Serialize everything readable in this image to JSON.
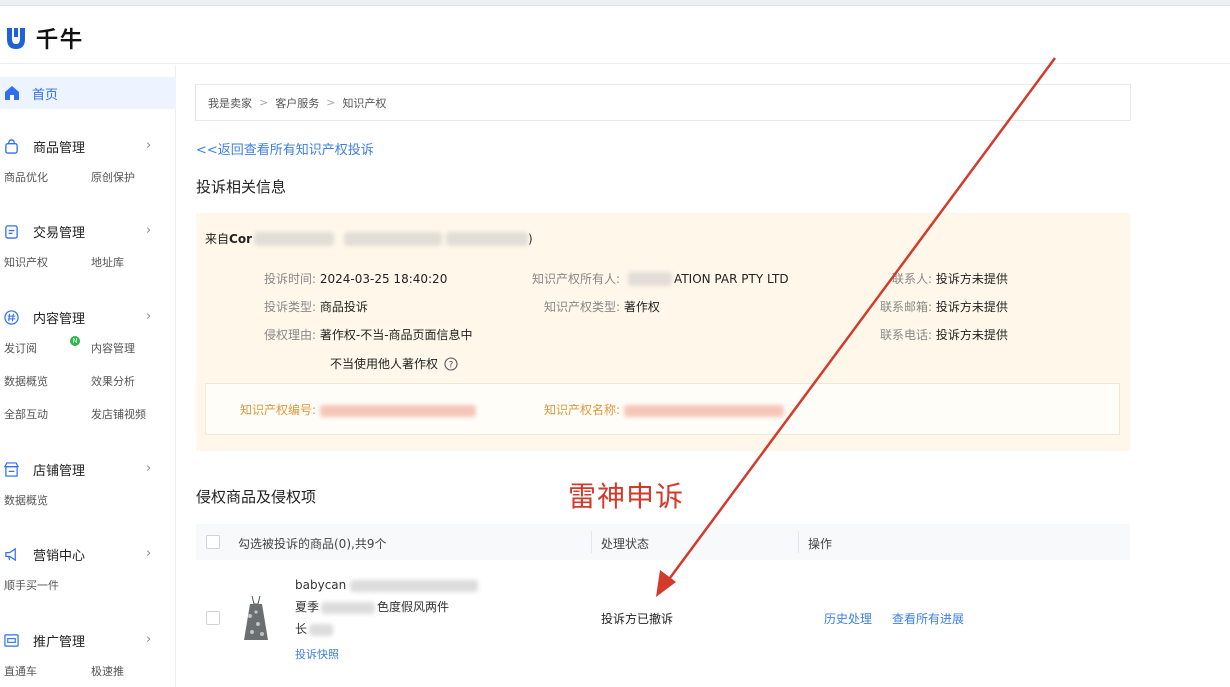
{
  "app": {
    "name": "千牛",
    "logo_icon": "qianniu-logo-icon"
  },
  "sidebar": {
    "home": {
      "label": "首页",
      "icon": "home-icon"
    },
    "groups": [
      {
        "label": "商品管理",
        "icon": "bag-icon",
        "subs": [
          "商品优化",
          "原创保护"
        ]
      },
      {
        "label": "交易管理",
        "icon": "order-icon",
        "subs": [
          "知识产权",
          "地址库"
        ]
      },
      {
        "label": "内容管理",
        "icon": "hash-icon",
        "subs": [
          "发订阅",
          "内容管理",
          "数据概览",
          "效果分析",
          "全部互动",
          "发店铺视频"
        ],
        "badge": "N"
      },
      {
        "label": "店铺管理",
        "icon": "shop-icon",
        "subs": [
          "数据概览"
        ]
      },
      {
        "label": "营销中心",
        "icon": "megaphone-icon",
        "subs": [
          "顺手买一件"
        ]
      },
      {
        "label": "推广管理",
        "icon": "promo-icon",
        "subs": [
          "直通车",
          "极速推"
        ]
      }
    ]
  },
  "breadcrumb": [
    "我是卖家",
    "客户服务",
    "知识产权"
  ],
  "back_link": "<<返回查看所有知识产权投诉",
  "complaint": {
    "section_title": "投诉相关信息",
    "from_prefix": "来自",
    "from_name": "Cor",
    "from_suffix": ")",
    "fields": {
      "time_label": "投诉时间:",
      "time_value": "2024-03-25 18:40:20",
      "type_label": "投诉类型:",
      "type_value": "商品投诉",
      "reason_label": "侵权理由:",
      "reason_value_1": "著作权-不当-商品页面信息中",
      "reason_value_2": "不当使用他人著作权",
      "owner_label": "知识产权所有人:",
      "owner_value": "ATION PAR PTY LTD",
      "ip_type_label": "知识产权类型:",
      "ip_type_value": "著作权",
      "contact_label": "联系人:",
      "contact_value": "投诉方未提供",
      "email_label": "联系邮箱:",
      "email_value": "投诉方未提供",
      "phone_label": "联系电话:",
      "phone_value": "投诉方未提供"
    },
    "ip_number_label": "知识产权编号:",
    "ip_name_label": "知识产权名称:"
  },
  "annotation": "雷神申诉",
  "infringing": {
    "section_title": "侵权商品及侵权项",
    "table": {
      "col_select": "勾选被投诉的商品(0),共9个",
      "col_status": "处理状态",
      "col_action": "操作"
    },
    "rows": [
      {
        "title_line_1": "babycan",
        "title_line_2": "夏季",
        "title_line_2b": "色度假风两件",
        "title_line_3": "长",
        "snapshot": "投诉快照",
        "status": "投诉方已撤诉",
        "action_1": "历史处理",
        "action_2": "查看所有进展"
      }
    ]
  },
  "colors": {
    "accent": "#3d7fe0",
    "annotation": "#d23a2c",
    "info_bg": "#fff8ea",
    "warn_label": "#e2963a"
  }
}
